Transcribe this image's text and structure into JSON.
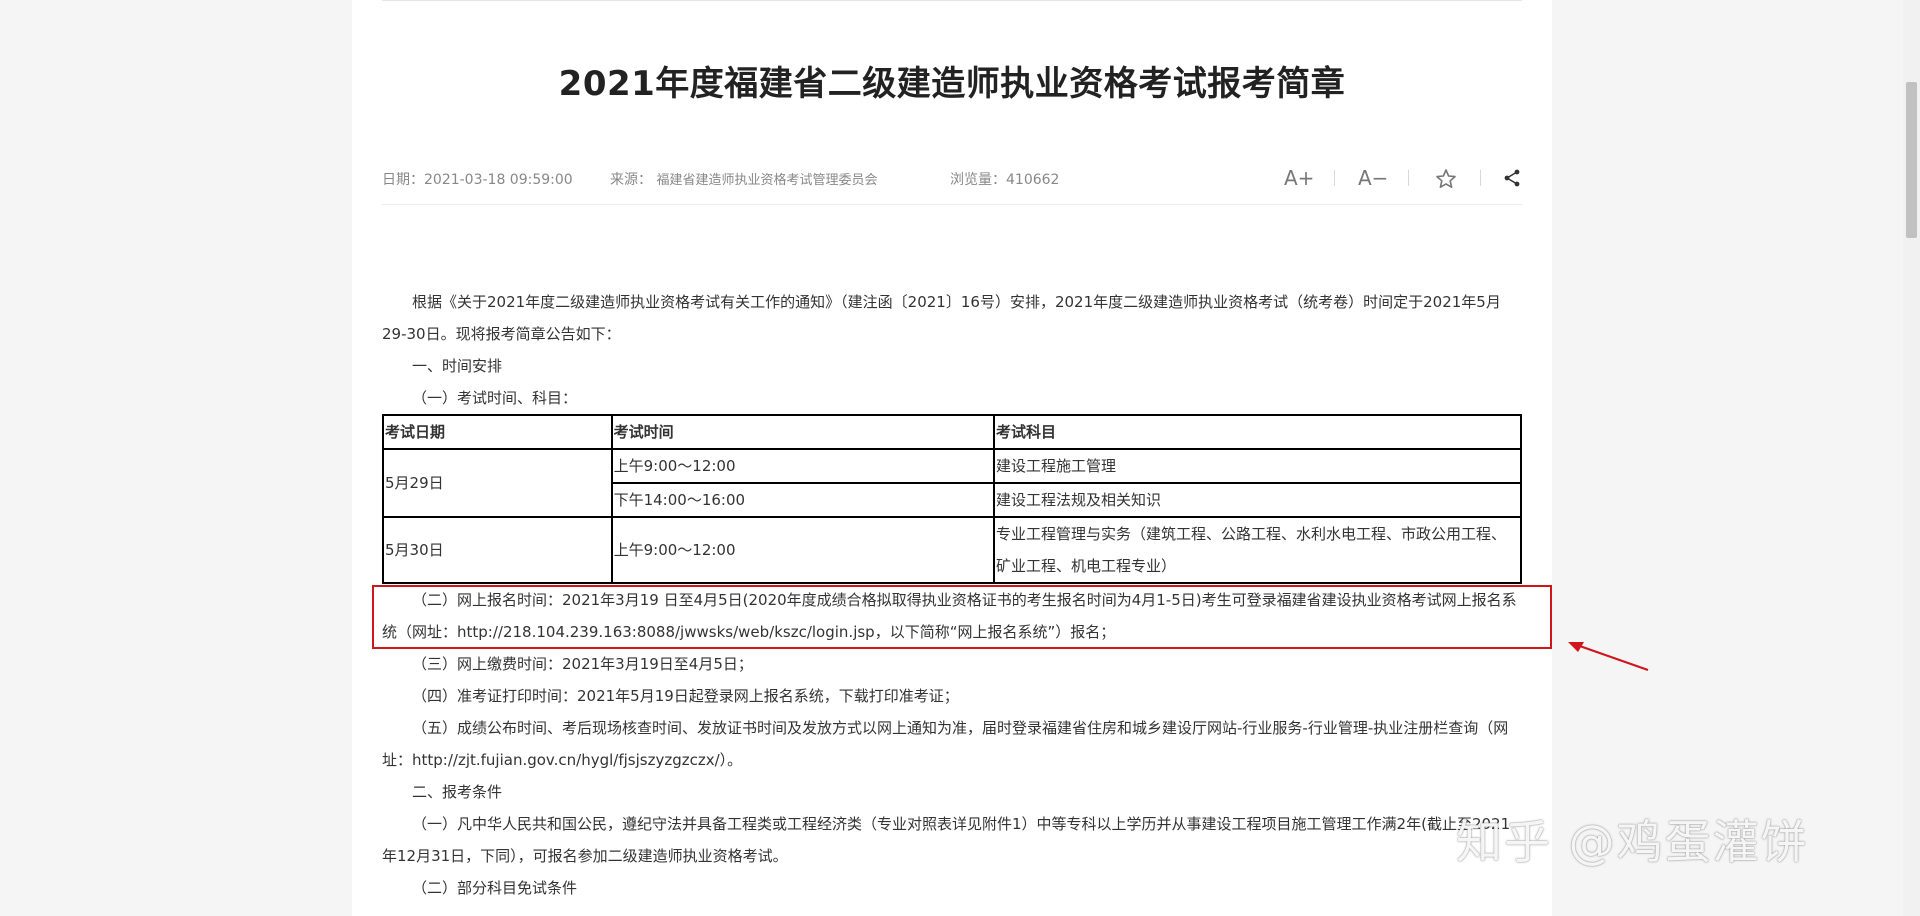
{
  "article": {
    "title": "2021年度福建省二级建造师执业资格考试报考简章",
    "meta": {
      "date_label": "日期：",
      "date": "2021-03-18 09:59:00",
      "source_label": "来源：",
      "source": "福建省建造师执业资格考试管理委员会",
      "views_label": "浏览量：",
      "views": "410662"
    },
    "tools": {
      "font_increase": "A+",
      "font_decrease": "A−"
    },
    "paragraphs": {
      "intro": "根据《关于2021年度二级建造师执业资格考试有关工作的通知》（建注函〔2021〕16号）安排，2021年度二级建造师执业资格考试（统考卷）时间定于2021年5月29-30日。现将报考简章公告如下：",
      "sec1": "一、时间安排",
      "sec1_1": "（一）考试时间、科目：",
      "sec1_2": "（二）网上报名时间：2021年3月19 日至4月5日(2020年度成绩合格拟取得执业资格证书的考生报名时间为4月1-5日)考生可登录福建省建设执业资格考试网上报名系统（网址：http://218.104.239.163:8088/jwwsks/web/kszc/login.jsp，以下简称“网上报名系统”）报名；",
      "sec1_3": "（三）网上缴费时间：2021年3月19日至4月5日；",
      "sec1_4": "（四）准考证打印时间：2021年5月19日起登录网上报名系统，下载打印准考证；",
      "sec1_5": "（五）成绩公布时间、考后现场核查时间、发放证书时间及发放方式以网上通知为准，届时登录福建省住房和城乡建设厅网站-行业服务-行业管理-执业注册栏查询（网址：http://zjt.fujian.gov.cn/hygl/fjsjszyzgzczx/）。",
      "sec2": "二、报考条件",
      "sec2_1": "（一）凡中华人民共和国公民，遵纪守法并具备工程类或工程经济类（专业对照表详见附件1）中等专科以上学历并从事建设工程项目施工管理工作满2年(截止至2021年12月31日，下同），可报名参加二级建造师执业资格考试。",
      "sec2_2": "（二）部分科目免试条件"
    },
    "table": {
      "headers": [
        "考试日期",
        "考试时间",
        "考试科目"
      ],
      "rows": [
        {
          "date": "5月29日",
          "time": "上午9:00～12:00",
          "subject": "建设工程施工管理"
        },
        {
          "time": "下午14:00～16:00",
          "subject": "建设工程法规及相关知识"
        },
        {
          "date": "5月30日",
          "time": "上午9:00～12:00",
          "subject": "专业工程管理与实务（建筑工程、公路工程、水利水电工程、市政公用工程、矿业工程、机电工程专业）"
        }
      ]
    }
  },
  "watermark": "知乎 @鸡蛋灌饼",
  "colors": {
    "highlight": "#d0161b",
    "page_bg": "#ffffff",
    "outer_bg": "#f5f5f5"
  }
}
